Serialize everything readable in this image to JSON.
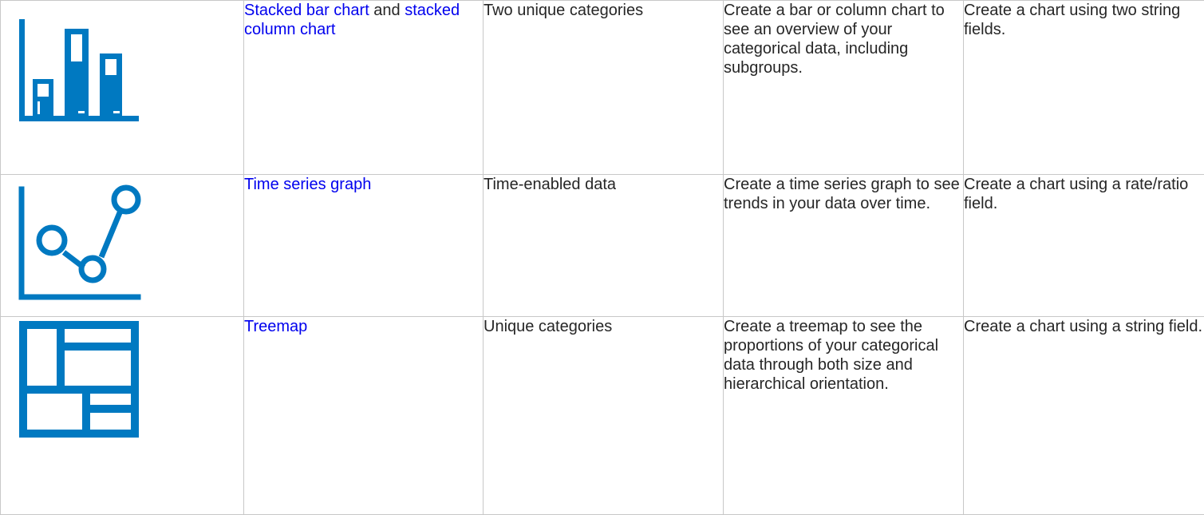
{
  "accent_color": "#0079c1",
  "link_color": "#0000ee",
  "rows": [
    {
      "icon": "stacked-bar-chart-icon",
      "name_link_1": "Stacked bar chart",
      "name_join": " and ",
      "name_link_2": "stacked column chart",
      "requirement": "Two unique categories",
      "description": "Create a bar or column chart to see an overview of your categorical data, including subgroups.",
      "usage": "Create a chart using two string fields."
    },
    {
      "icon": "time-series-graph-icon",
      "name_link_1": "Time series graph",
      "requirement": "Time-enabled data",
      "description": "Create a time series graph to see trends in your data over time.",
      "usage": "Create a chart using a rate/ratio field."
    },
    {
      "icon": "treemap-icon",
      "name_link_1": "Treemap",
      "requirement": "Unique categories",
      "description": "Create a treemap to see the proportions of your categorical data through both size and hierarchical orientation.",
      "usage": "Create a chart using a string field."
    }
  ]
}
